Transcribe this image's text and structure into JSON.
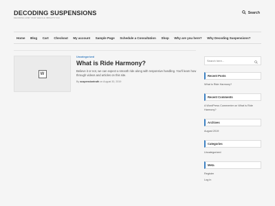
{
  "site": {
    "title": "DECODING SUSPENSIONS",
    "tagline": "DECODING HOW YOUR VEHICLE IMPACTS YOU",
    "search_label": "Search"
  },
  "nav": {
    "items": [
      {
        "label": "Home"
      },
      {
        "label": "Blog"
      },
      {
        "label": "Cart"
      },
      {
        "label": "Checkout"
      },
      {
        "label": "My account"
      },
      {
        "label": "Sample Page"
      },
      {
        "label": "Schedule a Consultation"
      },
      {
        "label": "Shop"
      },
      {
        "label": "Why are you here?"
      },
      {
        "label": "Why Decoding Suspensions?"
      }
    ]
  },
  "post": {
    "thumbnail_icon": "wordpress-logo-icon",
    "thumbnail_letter": "W",
    "category": "Uncategorized",
    "title": "What is Ride Harmony?",
    "excerpt": "Believe it or not, we can expect a smooth ride along with responsive handling. You'll learn how through videos and articles on this site.",
    "meta_prefix": "By",
    "author": "suspensiontruth",
    "meta_on": "on",
    "date": "August 30, 2019"
  },
  "sidebar": {
    "search_placeholder": "Search here...",
    "recent_posts": {
      "title": "Recent Posts",
      "items": [
        "What is Ride Harmony?"
      ]
    },
    "recent_comments": {
      "title": "Recent Comments",
      "author": "A WordPress Commenter",
      "on": "on",
      "post": "What is Ride Harmony?"
    },
    "archives": {
      "title": "Archives",
      "items": [
        "August 2019"
      ]
    },
    "categories": {
      "title": "Categories",
      "items": [
        "Uncategorized"
      ]
    },
    "meta": {
      "title": "Meta",
      "items": [
        "Register",
        "Log in"
      ]
    }
  },
  "colors": {
    "accent": "#3a7fc1",
    "background": "#f5f5f5"
  }
}
